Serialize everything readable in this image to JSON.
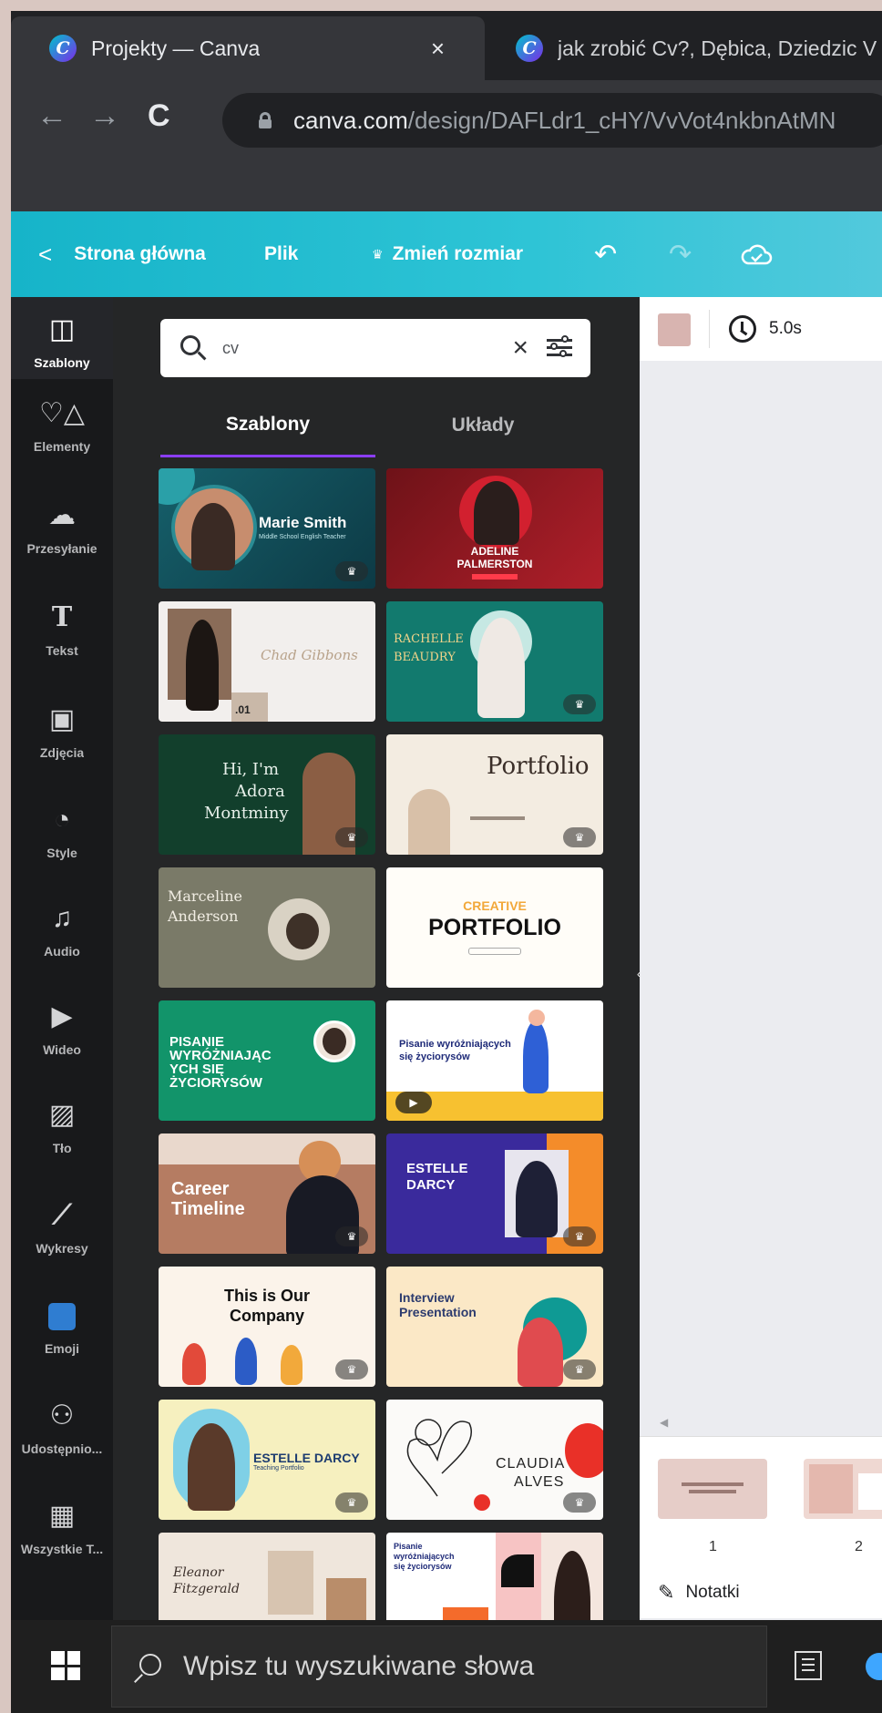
{
  "browser": {
    "tabs": [
      {
        "title": "Projekty — Canva",
        "close": "×"
      },
      {
        "title": "jak zrobić Cv?, Dębica, Dziedzic V"
      }
    ],
    "url_host": "canva.com",
    "url_path": "/design/DAFLdr1_cHY/VvVot4nkbnAtMN"
  },
  "toolbar": {
    "back_label": "Strona główna",
    "file_label": "Plik",
    "resize_label": "Zmień rozmiar"
  },
  "rail": {
    "items": [
      {
        "label": "Szablony",
        "icon": "template-icon"
      },
      {
        "label": "Elementy",
        "icon": "elements-icon"
      },
      {
        "label": "Przesyłanie",
        "icon": "upload-icon"
      },
      {
        "label": "Tekst",
        "icon": "text-icon"
      },
      {
        "label": "Zdjęcia",
        "icon": "photos-icon"
      },
      {
        "label": "Style",
        "icon": "styles-icon"
      },
      {
        "label": "Audio",
        "icon": "audio-icon"
      },
      {
        "label": "Wideo",
        "icon": "video-icon"
      },
      {
        "label": "Tło",
        "icon": "background-icon"
      },
      {
        "label": "Wykresy",
        "icon": "charts-icon"
      },
      {
        "label": "Emoji",
        "icon": "emoji-icon"
      },
      {
        "label": "Udostępnio...",
        "icon": "shared-icon"
      },
      {
        "label": "Wszystkie T...",
        "icon": "apps-icon"
      }
    ]
  },
  "panel": {
    "search_value": "cv",
    "tabs": [
      "Szablony",
      "Układy"
    ],
    "templates": [
      {
        "name": "template-marie-smith",
        "line1": "Marie Smith",
        "line2": "Middle School English Teacher"
      },
      {
        "name": "template-adeline-palmerston",
        "line1": "ADELINE",
        "line2": "PALMERSTON"
      },
      {
        "name": "template-chad-gibbons",
        "line1": "Chad Gibbons",
        "line2": ".01"
      },
      {
        "name": "template-rachelle-beaudry",
        "line1": "RACHELLE",
        "line2": "BEAUDRY"
      },
      {
        "name": "template-adora-montminy",
        "line1": "Hi, I'm",
        "line2": "Adora",
        "line3": "Montminy"
      },
      {
        "name": "template-portfolio",
        "line1": "Portfolio"
      },
      {
        "name": "template-marceline-anderson",
        "line1": "Marceline",
        "line2": "Anderson"
      },
      {
        "name": "template-creative-portfolio",
        "line1": "CREATIVE",
        "line2": "PORTFOLIO"
      },
      {
        "name": "template-pisanie-green",
        "line1": "PISANIE",
        "line2": "WYRÓŻNIAJĄC",
        "line3": "YCH SIĘ",
        "line4": "ŻYCIORYSÓW"
      },
      {
        "name": "template-pisanie-yellow",
        "line1": "Pisanie wyróżniających",
        "line2": "się życiorysów"
      },
      {
        "name": "template-career-timeline",
        "line1": "Career",
        "line2": "Timeline"
      },
      {
        "name": "template-estelle-darcy-purple",
        "line1": "ESTELLE",
        "line2": "DARCY"
      },
      {
        "name": "template-our-company",
        "line1": "This is Our",
        "line2": "Company"
      },
      {
        "name": "template-interview",
        "line1": "Interview",
        "line2": "Presentation"
      },
      {
        "name": "template-estelle-darcy-yellow",
        "line1": "ESTELLE DARCY",
        "line2": "Teaching Portfolio"
      },
      {
        "name": "template-claudia-alves",
        "line1": "CLAUDIA",
        "line2": "ALVES"
      },
      {
        "name": "template-eleanor-fitzgerald",
        "line1": "Eleanor",
        "line2": "Fitzgerald"
      },
      {
        "name": "template-pisanie-dark",
        "line1": "Pisanie",
        "line2": "wyróżniających",
        "line3": "się życiorysów"
      }
    ]
  },
  "editor": {
    "duration": "5.0s",
    "pages": [
      {
        "num": "1"
      },
      {
        "num": "2"
      }
    ],
    "notes_label": "Notatki"
  },
  "taskbar": {
    "search_placeholder": "Wpisz tu wyszukiwane słowa"
  },
  "colors": {
    "canva_teal": "#16b4c9",
    "accent_purple": "#8b3dff",
    "panel_bg": "#252627",
    "rail_bg": "#18191b"
  }
}
